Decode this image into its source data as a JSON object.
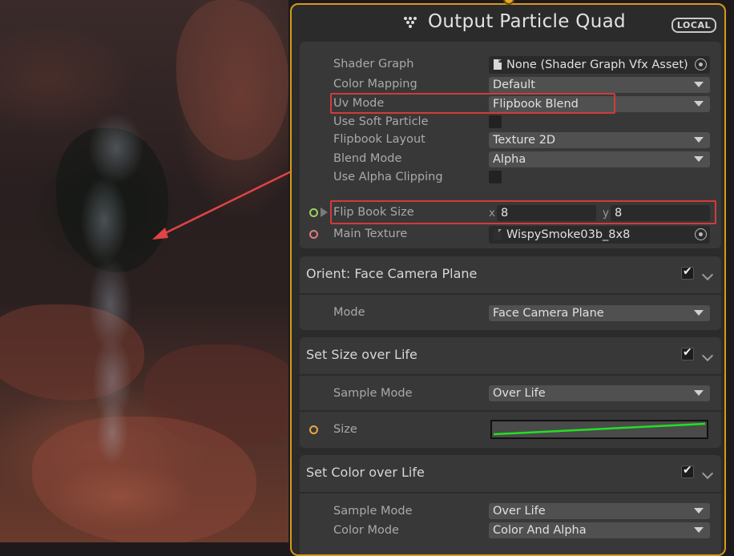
{
  "node": {
    "title": "Output Particle Quad",
    "badge": "LOCAL",
    "properties": [
      {
        "label": "Shader Graph",
        "value": "None (Shader Graph Vfx Asset)"
      },
      {
        "label": "Color Mapping",
        "value": "Default"
      },
      {
        "label": "Uv Mode",
        "value": "Flipbook Blend"
      },
      {
        "label": "Use Soft Particle"
      },
      {
        "label": "Flipbook Layout",
        "value": "Texture 2D"
      },
      {
        "label": "Blend Mode",
        "value": "Alpha"
      },
      {
        "label": "Use Alpha Clipping"
      }
    ],
    "flipbook_size": {
      "label": "Flip Book Size",
      "x_label": "x",
      "x": "8",
      "y_label": "y",
      "y": "8"
    },
    "main_texture": {
      "label": "Main Texture",
      "value": "WispySmoke03b_8x8"
    }
  },
  "blocks": [
    {
      "title": "Orient: Face Camera Plane",
      "rows": [
        {
          "label": "Mode",
          "value": "Face Camera Plane"
        }
      ]
    },
    {
      "title": "Set Size over Life",
      "rows": [
        {
          "label": "Sample Mode",
          "value": "Over Life"
        },
        {
          "label": "Size"
        }
      ]
    },
    {
      "title": "Set Color over Life",
      "rows": [
        {
          "label": "Sample Mode",
          "value": "Over Life"
        },
        {
          "label": "Color Mode",
          "value": "Color And Alpha"
        }
      ]
    }
  ],
  "colors": {
    "node_border": "#d59a1a",
    "highlight": "#d23b3b",
    "curve": "#22e022"
  }
}
